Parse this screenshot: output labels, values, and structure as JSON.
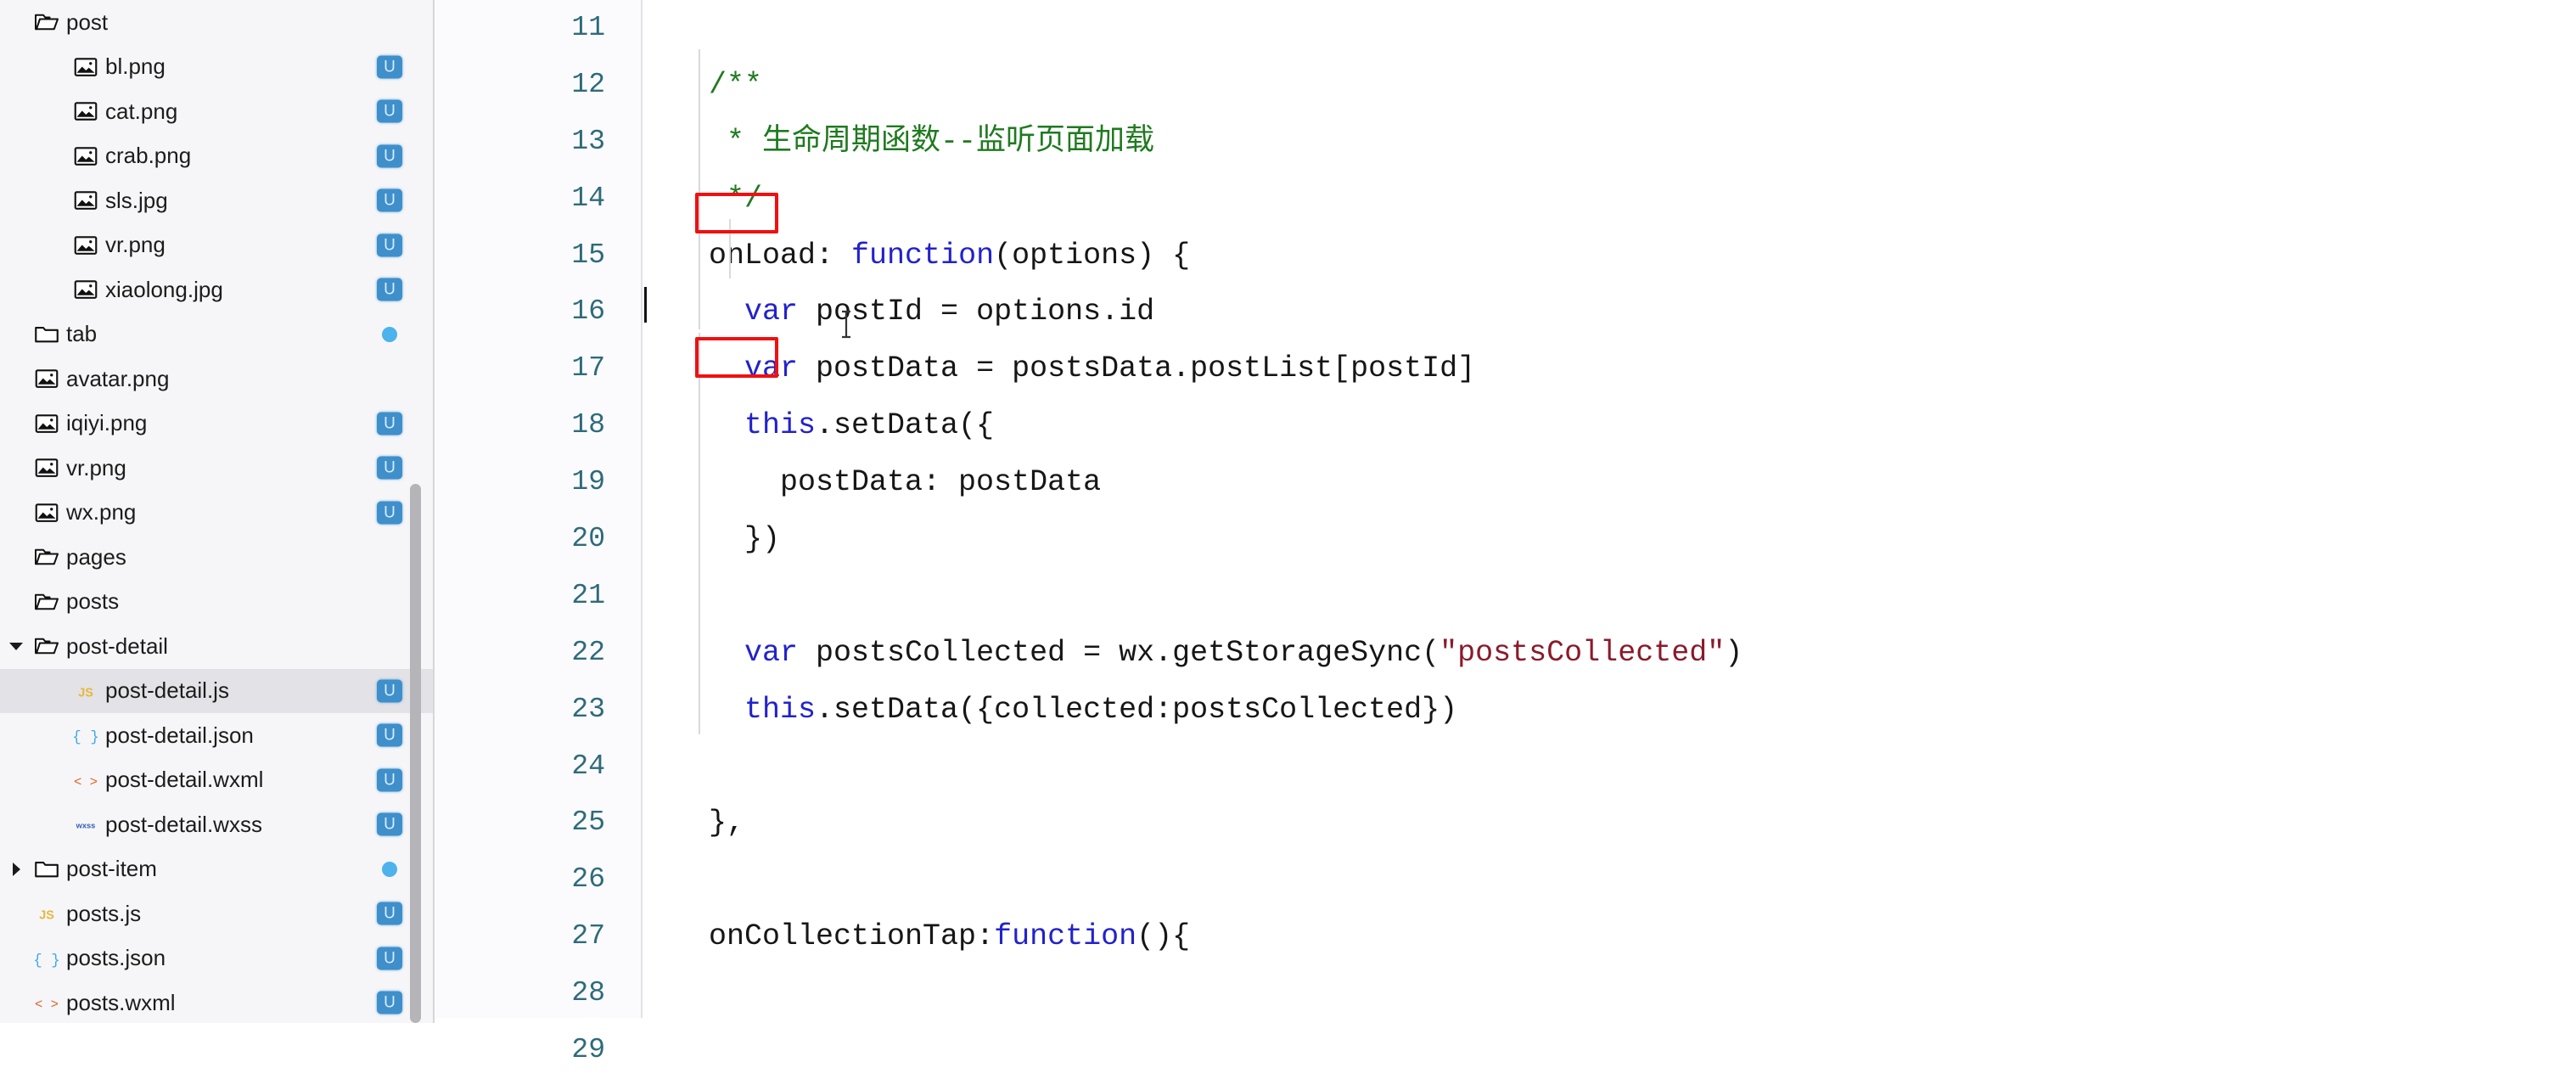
{
  "sidebar": {
    "items": [
      {
        "name": "post",
        "type": "folder-open",
        "depth": 0,
        "twisty": "none",
        "badge": "none",
        "selected": false
      },
      {
        "name": "bl.png",
        "type": "image",
        "depth": 1,
        "twisty": "none",
        "badge": "U",
        "selected": false
      },
      {
        "name": "cat.png",
        "type": "image",
        "depth": 1,
        "twisty": "none",
        "badge": "U",
        "selected": false
      },
      {
        "name": "crab.png",
        "type": "image",
        "depth": 1,
        "twisty": "none",
        "badge": "U",
        "selected": false
      },
      {
        "name": "sls.jpg",
        "type": "image",
        "depth": 1,
        "twisty": "none",
        "badge": "U",
        "selected": false
      },
      {
        "name": "vr.png",
        "type": "image",
        "depth": 1,
        "twisty": "none",
        "badge": "U",
        "selected": false
      },
      {
        "name": "xiaolong.jpg",
        "type": "image",
        "depth": 1,
        "twisty": "none",
        "badge": "U",
        "selected": false
      },
      {
        "name": "tab",
        "type": "folder-closed",
        "depth": 0,
        "twisty": "none",
        "badge": "dot",
        "selected": false
      },
      {
        "name": "avatar.png",
        "type": "image",
        "depth": 0,
        "twisty": "none",
        "badge": "none",
        "selected": false
      },
      {
        "name": "iqiyi.png",
        "type": "image",
        "depth": 0,
        "twisty": "none",
        "badge": "U",
        "selected": false
      },
      {
        "name": "vr.png",
        "type": "image",
        "depth": 0,
        "twisty": "none",
        "badge": "U",
        "selected": false
      },
      {
        "name": "wx.png",
        "type": "image",
        "depth": 0,
        "twisty": "none",
        "badge": "U",
        "selected": false
      },
      {
        "name": "pages",
        "type": "folder-open",
        "depth": 0,
        "twisty": "none",
        "badge": "none",
        "selected": false
      },
      {
        "name": "posts",
        "type": "folder-open",
        "depth": 0,
        "twisty": "none",
        "badge": "none",
        "selected": false
      },
      {
        "name": "post-detail",
        "type": "folder-open",
        "depth": 0,
        "twisty": "open",
        "badge": "none",
        "selected": false
      },
      {
        "name": "post-detail.js",
        "type": "js",
        "depth": 1,
        "twisty": "none",
        "badge": "U",
        "selected": true
      },
      {
        "name": "post-detail.json",
        "type": "json",
        "depth": 1,
        "twisty": "none",
        "badge": "U",
        "selected": false
      },
      {
        "name": "post-detail.wxml",
        "type": "wxml",
        "depth": 1,
        "twisty": "none",
        "badge": "U",
        "selected": false
      },
      {
        "name": "post-detail.wxss",
        "type": "wxss",
        "depth": 1,
        "twisty": "none",
        "badge": "U",
        "selected": false
      },
      {
        "name": "post-item",
        "type": "folder-closed",
        "depth": 0,
        "twisty": "closed",
        "badge": "dot",
        "selected": false
      },
      {
        "name": "posts.js",
        "type": "js",
        "depth": 0,
        "twisty": "none",
        "badge": "U",
        "selected": false
      },
      {
        "name": "posts.json",
        "type": "json",
        "depth": 0,
        "twisty": "none",
        "badge": "U",
        "selected": false
      },
      {
        "name": "posts.wxml",
        "type": "wxml",
        "depth": 0,
        "twisty": "none",
        "badge": "U",
        "selected": false
      }
    ],
    "badge_label": "U"
  },
  "editor": {
    "line_numbers": [
      "11",
      "12",
      "13",
      "14",
      "15",
      "16",
      "17",
      "18",
      "19",
      "20",
      "21",
      "22",
      "23",
      "24",
      "25",
      "26",
      "27",
      "28",
      "29"
    ],
    "lines": [
      {
        "n": "11",
        "tokens": []
      },
      {
        "n": "12",
        "tokens": [
          {
            "t": "  /**",
            "c": "cm"
          }
        ]
      },
      {
        "n": "13",
        "tokens": [
          {
            "t": "   * ",
            "c": "cm"
          },
          {
            "t": "生命周期函数--监听页面加载",
            "c": "cm"
          }
        ]
      },
      {
        "n": "14",
        "tokens": [
          {
            "t": "   */",
            "c": "cm"
          }
        ]
      },
      {
        "n": "15",
        "tokens": [
          {
            "t": "  onLoad: ",
            "c": "pl"
          },
          {
            "t": "function",
            "c": "kw"
          },
          {
            "t": "(options) {",
            "c": "pl"
          }
        ]
      },
      {
        "n": "16",
        "tokens": [
          {
            "t": "    ",
            "c": "pl"
          },
          {
            "t": "var",
            "c": "kw"
          },
          {
            "t": " postId = options.id",
            "c": "pl"
          }
        ]
      },
      {
        "n": "17",
        "tokens": [
          {
            "t": "    ",
            "c": "pl"
          },
          {
            "t": "var",
            "c": "kw"
          },
          {
            "t": " postData = postsData.postList[postId]",
            "c": "pl"
          }
        ]
      },
      {
        "n": "18",
        "tokens": [
          {
            "t": "    ",
            "c": "pl"
          },
          {
            "t": "this",
            "c": "kw"
          },
          {
            "t": ".setData({",
            "c": "pl"
          }
        ]
      },
      {
        "n": "19",
        "tokens": [
          {
            "t": "      postData: postData",
            "c": "pl"
          }
        ]
      },
      {
        "n": "20",
        "tokens": [
          {
            "t": "    })",
            "c": "pl"
          }
        ]
      },
      {
        "n": "21",
        "tokens": []
      },
      {
        "n": "22",
        "tokens": [
          {
            "t": "    ",
            "c": "pl"
          },
          {
            "t": "var",
            "c": "kw"
          },
          {
            "t": " postsCollected = wx.getStorageSync(",
            "c": "pl"
          },
          {
            "t": "\"postsCollected\"",
            "c": "str"
          },
          {
            "t": ")",
            "c": "pl"
          }
        ]
      },
      {
        "n": "23",
        "tokens": [
          {
            "t": "    ",
            "c": "pl"
          },
          {
            "t": "this",
            "c": "kw"
          },
          {
            "t": ".setData({collected:postsCollected})",
            "c": "pl"
          }
        ]
      },
      {
        "n": "24",
        "tokens": []
      },
      {
        "n": "25",
        "tokens": [
          {
            "t": "  },",
            "c": "pl"
          }
        ]
      },
      {
        "n": "26",
        "tokens": []
      },
      {
        "n": "27",
        "tokens": [
          {
            "t": "  onCollectionTap:",
            "c": "pl"
          },
          {
            "t": "function",
            "c": "kw"
          },
          {
            "t": "(){",
            "c": "pl"
          }
        ]
      },
      {
        "n": "28",
        "tokens": []
      },
      {
        "n": "29",
        "tokens": [
          {
            "t": "  }",
            "c": "pl"
          }
        ]
      }
    ],
    "highlights": [
      {
        "label": "this",
        "line": "18"
      },
      {
        "label": "this",
        "line": "23"
      }
    ],
    "caret_line": "21"
  },
  "colors": {
    "keyword": "#2222cc",
    "comment": "#1f7a1f",
    "string": "#8b1a2b",
    "highlight_box": "#f01010",
    "badge_bg": "#3f8fcb",
    "dot": "#4cb3ec",
    "selected_row": "#e3e2e6",
    "line_number": "#2e6b7a"
  }
}
